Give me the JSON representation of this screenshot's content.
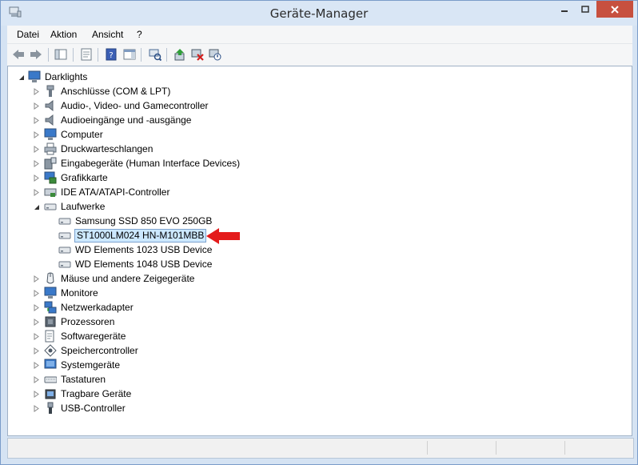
{
  "window": {
    "title": "Geräte-Manager"
  },
  "menu": [
    "Datei",
    "Aktion",
    "Ansicht",
    "?"
  ],
  "tree": {
    "root": "Darklights",
    "categories": [
      "Anschlüsse (COM & LPT)",
      "Audio-, Video- und Gamecontroller",
      "Audioeingänge und -ausgänge",
      "Computer",
      "Druckwarteschlangen",
      "Eingabegeräte (Human Interface Devices)",
      "Grafikkarte",
      "IDE ATA/ATAPI-Controller",
      "Laufwerke",
      "Mäuse und andere Zeigegeräte",
      "Monitore",
      "Netzwerkadapter",
      "Prozessoren",
      "Softwaregeräte",
      "Speichercontroller",
      "Systemgeräte",
      "Tastaturen",
      "Tragbare Geräte",
      "USB-Controller"
    ],
    "drives": [
      "Samsung SSD 850 EVO 250GB",
      "ST1000LM024 HN-M101MBB",
      "WD Elements 1023 USB Device",
      "WD Elements 1048 USB Device"
    ]
  },
  "colors": {
    "selection": "#cce8ff",
    "annotation_arrow": "#e41b1b",
    "close_button": "#c7503f"
  }
}
